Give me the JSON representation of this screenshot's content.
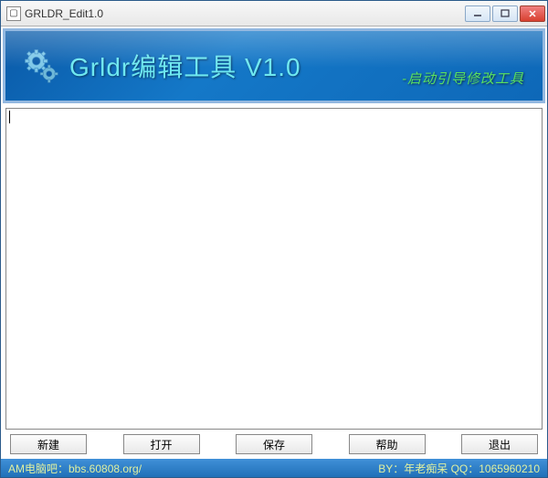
{
  "window": {
    "title": "GRLDR_Edit1.0"
  },
  "header": {
    "app_title": "Grldr编辑工具 V1.0",
    "subtitle": "-启动引导修改工具"
  },
  "editor": {
    "content": ""
  },
  "buttons": {
    "new": "新建",
    "open": "打开",
    "save": "保存",
    "help": "帮助",
    "exit": "退出"
  },
  "statusbar": {
    "left": "AM电脑吧：bbs.60808.org/",
    "right": "BY：年老痴呆 QQ：1065960210"
  }
}
